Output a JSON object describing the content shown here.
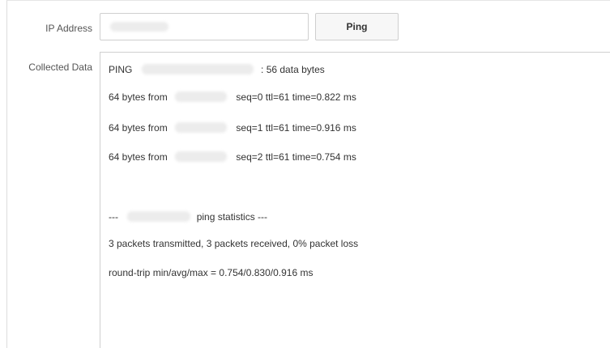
{
  "form": {
    "ip_label": "IP Address",
    "ip_value_redacted": true,
    "ping_button": "Ping",
    "collected_label": "Collected Data"
  },
  "output": {
    "line1_prefix": "PING",
    "line1_suffix": ": 56 data bytes",
    "reply_prefix": "64 bytes from",
    "reply0": "seq=0 ttl=61 time=0.822 ms",
    "reply1": "seq=1 ttl=61 time=0.916 ms",
    "reply2": "seq=2 ttl=61 time=0.754 ms",
    "stats_prefix": "---",
    "stats_suffix": "ping statistics ---",
    "packets": "3 packets transmitted, 3 packets received, 0% packet loss",
    "rtt": "round-trip min/avg/max = 0.754/0.830/0.916 ms"
  }
}
